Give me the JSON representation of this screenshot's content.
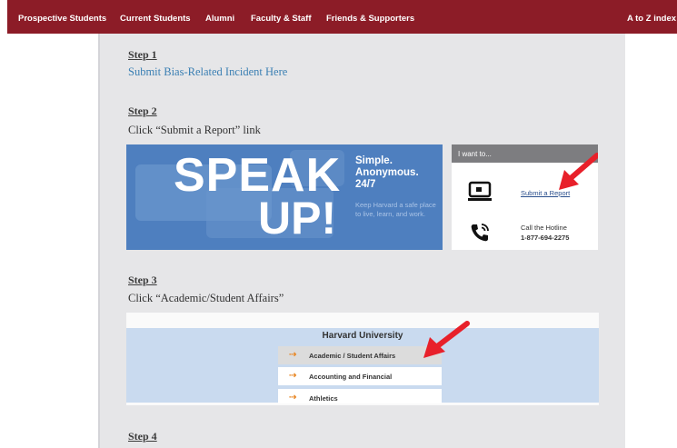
{
  "nav": {
    "items": [
      "Prospective Students",
      "Current Students",
      "Alumni",
      "Faculty & Staff",
      "Friends & Supporters"
    ],
    "index_link": "A to Z index"
  },
  "colors": {
    "nav_bg": "#8c1c27",
    "banner_bg": "#4e7fbf",
    "link": "#3a7fb3",
    "arrow": "#e8202a"
  },
  "steps": [
    {
      "heading": "Step 1",
      "text": "Submit Bias-Related Incident Here"
    },
    {
      "heading": "Step 2",
      "text": "Click “Submit a Report” link"
    },
    {
      "heading": "Step 3",
      "text": "Click “Academic/Student Affairs”"
    },
    {
      "heading": "Step 4"
    }
  ],
  "speakup": {
    "line1": "SPEAK",
    "line2": "UP!",
    "tagline": "Simple. Anonymous. 24/7",
    "subtext": "Keep Harvard a safe place to live, learn, and work."
  },
  "iwant": {
    "header": "I want to...",
    "report_link": "Submit a Report",
    "hotline_label": "Call the Hotline",
    "hotline_number": "1-877-694-2275",
    "icons": [
      "computer-icon",
      "phone-icon",
      "red-arrow-icon"
    ]
  },
  "harvard": {
    "title": "Harvard University",
    "rows": [
      "Academic / Student Affairs",
      "Accounting and Financial",
      "Athletics"
    ]
  }
}
